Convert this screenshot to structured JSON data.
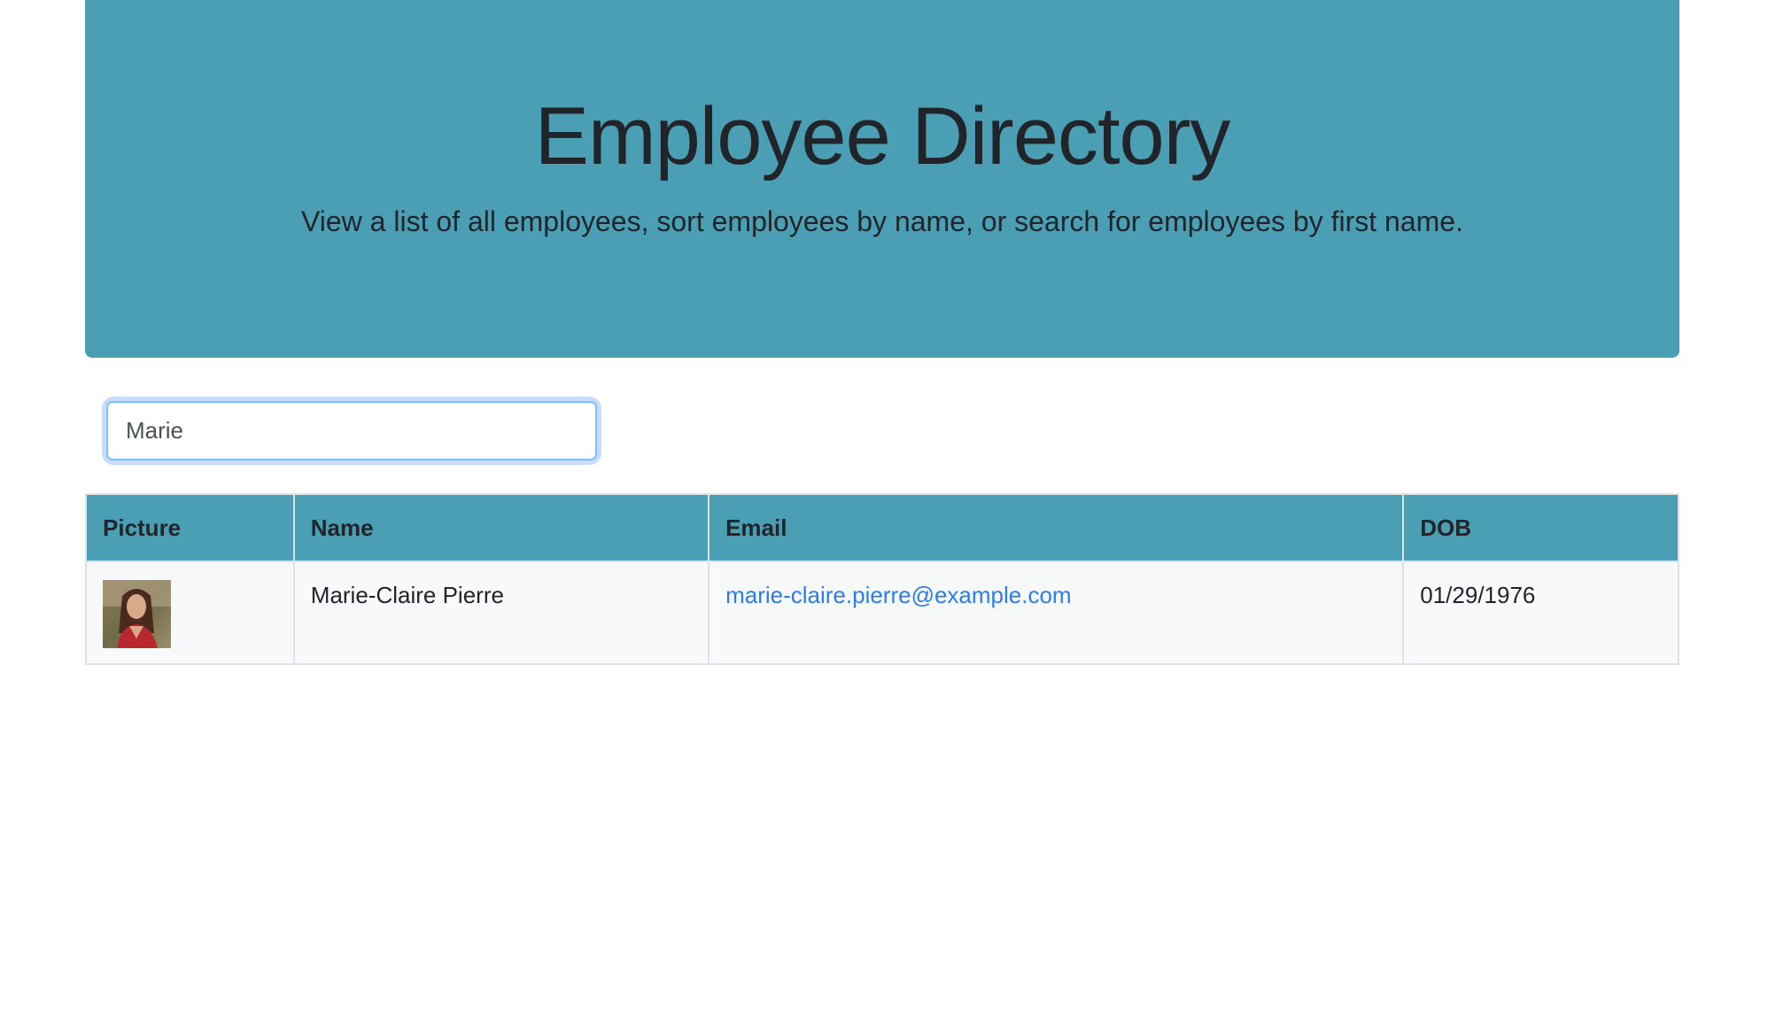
{
  "header": {
    "title": "Employee Directory",
    "subtitle": "View a list of all employees, sort employees by name, or search for employees by first name."
  },
  "search": {
    "value": "Marie",
    "placeholder": ""
  },
  "table": {
    "columns": [
      "Picture",
      "Name",
      "Email",
      "DOB"
    ],
    "rows": [
      {
        "picture": "employee-photo",
        "name": "Marie-Claire Pierre",
        "email": "marie-claire.pierre@example.com",
        "dob": "01/29/1976"
      }
    ]
  },
  "colors": {
    "header_bg": "#4a9fb5",
    "link": "#2b7de9",
    "row_bg": "#f8f9fa"
  }
}
